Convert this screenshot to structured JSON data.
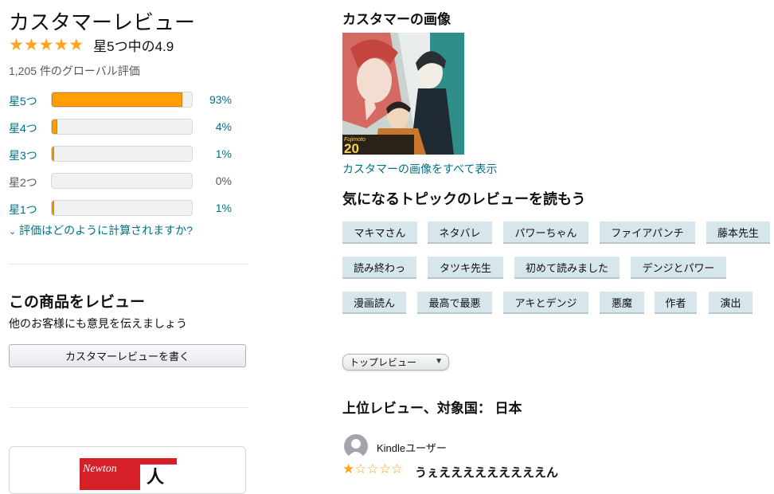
{
  "reviews": {
    "title": "カスタマーレビュー",
    "avg_text": "星5つ中の4.9",
    "rating": 4.9,
    "global_count": "1,205 件のグローバル評価",
    "histogram": [
      {
        "label": "星5つ",
        "pct_text": "93%",
        "pct": 93
      },
      {
        "label": "星4つ",
        "pct_text": "4%",
        "pct": 4
      },
      {
        "label": "星3つ",
        "pct_text": "1%",
        "pct": 1
      },
      {
        "label": "星2つ",
        "pct_text": "0%",
        "pct": 0
      },
      {
        "label": "星1つ",
        "pct_text": "1%",
        "pct": 1
      }
    ],
    "how_calc": "評価はどのように計算されますか?"
  },
  "review_product": {
    "title": "この商品をレビュー",
    "subtitle": "他のお客様にも意見を伝えましょう",
    "button": "カスタマーレビューを書く"
  },
  "ad": {
    "brand": "Newton",
    "char": "人"
  },
  "customer_images": {
    "title": "カスタマーの画像",
    "see_all": "カスタマーの画像をすべて表示",
    "thumb_badge": "20"
  },
  "topics": {
    "title": "気になるトピックのレビューを読もう",
    "rows": [
      [
        "マキマさん",
        "ネタバレ",
        "パワーちゃん",
        "ファイアパンチ",
        "藤本先生"
      ],
      [
        "読み終わっ",
        "タツキ先生",
        "初めて読みました",
        "デンジとパワー"
      ],
      [
        "漫画読ん",
        "最高で最悪",
        "アキとデンジ",
        "悪魔",
        "作者",
        "演出"
      ]
    ]
  },
  "sort": {
    "selected": "トップレビュー"
  },
  "top_reviews": {
    "title": "上位レビュー、対象国： 日本",
    "first": {
      "reviewer": "Kindleユーザー",
      "rating": 1,
      "headline": "うぇえええええええええん"
    }
  },
  "colors": {
    "star": "#ffa41c",
    "link": "#007185",
    "bar_fill": "#ff9f00",
    "topic_bg": "#d7e6ea"
  }
}
